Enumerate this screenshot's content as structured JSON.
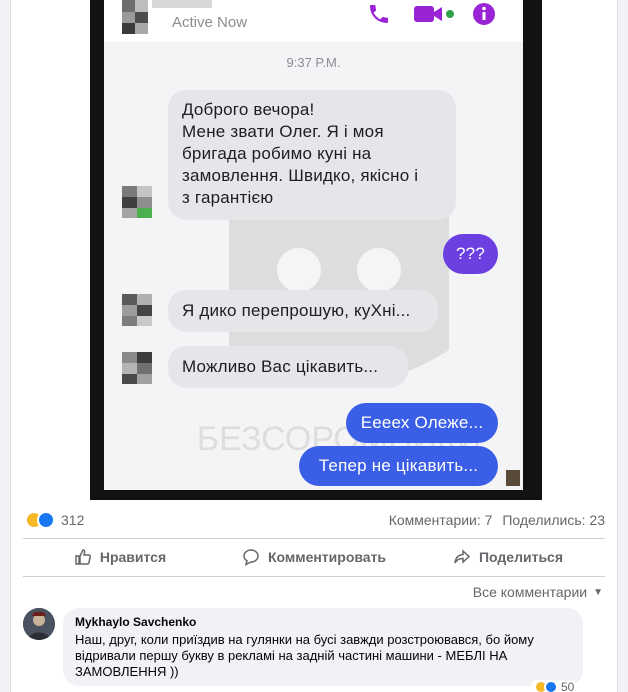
{
  "screenshot": {
    "active_status": "Active Now",
    "timestamp": "9:37 P.M.",
    "messages": [
      {
        "from": "other",
        "lines": [
          "Доброго вечора!",
          "Мене звати Олег. Я і моя",
          "бригада робимо куні на",
          "замовлення. Швидко, якісно і",
          "з гарантією"
        ]
      },
      {
        "from": "me",
        "text": "???"
      },
      {
        "from": "other",
        "text": "Я дико перепрошую, куХні..."
      },
      {
        "from": "other",
        "text": "Можливо Вас цікавить..."
      },
      {
        "from": "me",
        "text": "Еееех Олеже..."
      },
      {
        "from": "me",
        "text": "Тепер не цікавить..."
      }
    ],
    "watermark_text": "БЕЗСОРОМНИКИ"
  },
  "post": {
    "reaction_count": "312",
    "comments_count": "Комментарии: 7",
    "shares_count": "Поделились: 23",
    "actions": {
      "like": "Нравится",
      "comment": "Комментировать",
      "share": "Поделиться"
    },
    "all_comments": "Все комментарии"
  },
  "comment": {
    "author": "Mykhaylo Savchenko",
    "text_lines": [
      "Наш, друг, коли приїздив на гулянки на бусі завжди розстроювався, бо йому",
      "відривали першу букву в рекламі на задній частині машини - МЕБЛІ НА",
      "ЗАМОВЛЕННЯ ))"
    ],
    "reaction_count": "50"
  },
  "colors": {
    "messenger_blue": "#3b5ee6",
    "messenger_purple": "#6b3fe0",
    "header_icon": "#9b23d6",
    "like_blue": "#1877f2",
    "haha_yellow": "#f7b928"
  }
}
